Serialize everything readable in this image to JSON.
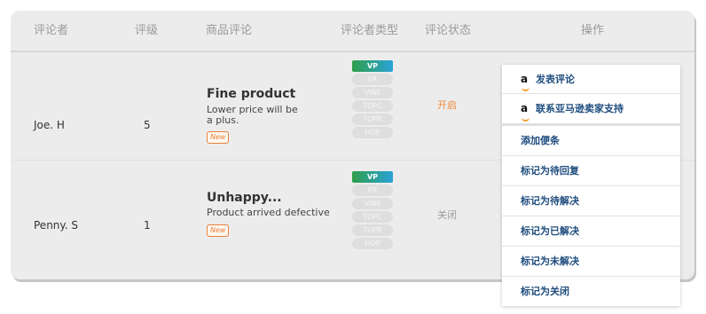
{
  "table": {
    "columns": {
      "reviewer": "评论者",
      "rating": "评级",
      "review": "商品评论",
      "reviewer_type": "评论者类型",
      "review_status": "评论状态",
      "actions": "操作"
    },
    "rows": [
      {
        "reviewer": "Joe. H",
        "rating": "5",
        "title": "Fine product",
        "body": "Lower price will be a plus.",
        "badge": "New",
        "tags": [
          "VP",
          "ER",
          "VINE",
          "TOPC",
          "TOPR",
          "HOP"
        ],
        "status": "开启",
        "status_color": "#f08a3c"
      },
      {
        "reviewer": "Penny. S",
        "rating": "1",
        "title": "Unhappy...",
        "body": "Product arrived defective",
        "badge": "New",
        "tags": [
          "VP",
          "ER",
          "VINE",
          "TOPC",
          "TOPR",
          "HOP"
        ],
        "status": "关闭",
        "status_color": "#9a9a9a"
      }
    ]
  },
  "menu": {
    "items": [
      {
        "label": "发表评论",
        "icon": "amazon-icon"
      },
      {
        "label": "联系亚马逊卖家支持",
        "icon": "amazon-icon"
      },
      {
        "label": "添加便条"
      },
      {
        "label": "标记为待回复"
      },
      {
        "label": "标记为待解决"
      },
      {
        "label": "标记为已解决"
      },
      {
        "label": "标记为未解决"
      },
      {
        "label": "标记为关闭"
      }
    ],
    "amazon_glyph": "a"
  },
  "colors": {
    "active_tag_start": "#2f9e4a",
    "active_tag_end": "#2aa3d8",
    "menu_text": "#1f4d7e",
    "new_badge": "#e8823a"
  }
}
